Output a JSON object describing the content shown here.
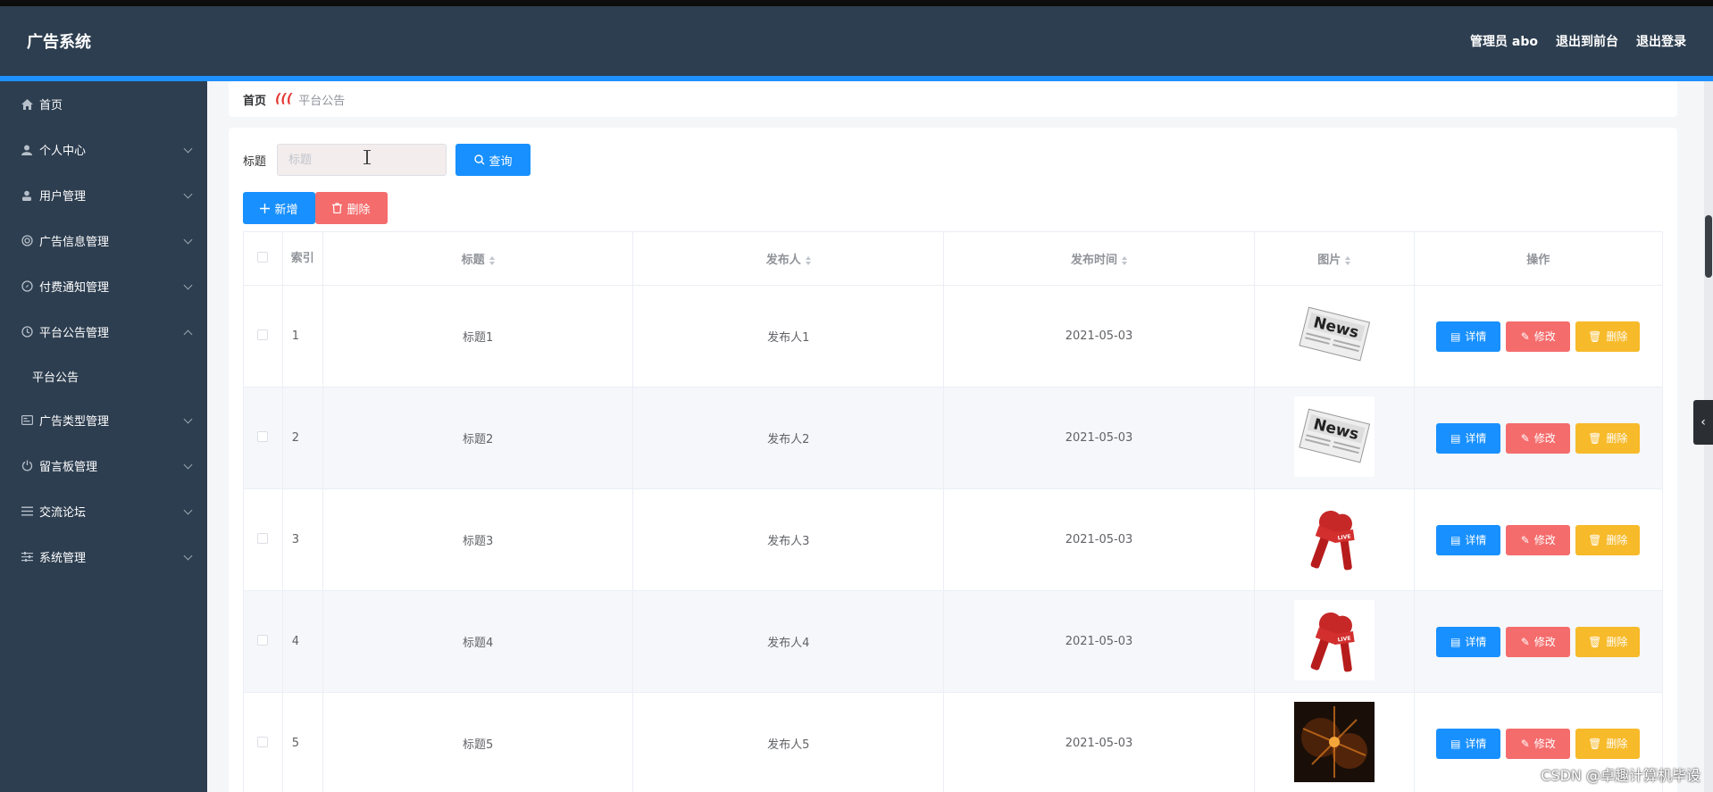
{
  "app": {
    "title": "广告系统"
  },
  "header": {
    "admin": "管理员 abo",
    "to_front": "退出到前台",
    "logout": "退出登录"
  },
  "sidebar": {
    "items": [
      {
        "label": "首页",
        "icon": "home-icon",
        "expandable": false
      },
      {
        "label": "个人中心",
        "icon": "person-icon",
        "expandable": true
      },
      {
        "label": "用户管理",
        "icon": "user-icon",
        "expandable": true
      },
      {
        "label": "广告信息管理",
        "icon": "target-icon",
        "expandable": true
      },
      {
        "label": "付费通知管理",
        "icon": "compass-icon",
        "expandable": true
      },
      {
        "label": "平台公告管理",
        "icon": "clock-icon",
        "expandable": true,
        "expanded": true,
        "children": [
          {
            "label": "平台公告"
          }
        ]
      },
      {
        "label": "广告类型管理",
        "icon": "card-icon",
        "expandable": true
      },
      {
        "label": "留言板管理",
        "icon": "power-icon",
        "expandable": true
      },
      {
        "label": "交流论坛",
        "icon": "list-icon",
        "expandable": true
      },
      {
        "label": "系统管理",
        "icon": "sliders-icon",
        "expandable": true
      }
    ]
  },
  "breadcrumb": {
    "home": "首页",
    "separator": "(((",
    "current": "平台公告"
  },
  "search": {
    "label": "标题",
    "placeholder": "标题",
    "value": "",
    "button": "查询"
  },
  "actions": {
    "add": "新增",
    "delete": "删除"
  },
  "table": {
    "headers": {
      "index": "索引",
      "title": "标题",
      "publisher": "发布人",
      "time": "发布时间",
      "image": "图片",
      "ops": "操作"
    },
    "rows": [
      {
        "index": "1",
        "title": "标题1",
        "publisher": "发布人1",
        "time": "2021-05-03",
        "image": "news"
      },
      {
        "index": "2",
        "title": "标题2",
        "publisher": "发布人2",
        "time": "2021-05-03",
        "image": "news"
      },
      {
        "index": "3",
        "title": "标题3",
        "publisher": "发布人3",
        "time": "2021-05-03",
        "image": "mic"
      },
      {
        "index": "4",
        "title": "标题4",
        "publisher": "发布人4",
        "time": "2021-05-03",
        "image": "mic"
      },
      {
        "index": "5",
        "title": "标题5",
        "publisher": "发布人5",
        "time": "2021-05-03",
        "image": "dark"
      }
    ],
    "row_buttons": {
      "detail": "详情",
      "edit": "修改",
      "delete": "删除"
    }
  },
  "watermark": "CSDN @卓趣计算机毕设",
  "colors": {
    "sidebar": "#2d3e50",
    "accent_blue": "#1890ff",
    "danger": "#f56c6c",
    "warning": "#f7ba2a"
  }
}
